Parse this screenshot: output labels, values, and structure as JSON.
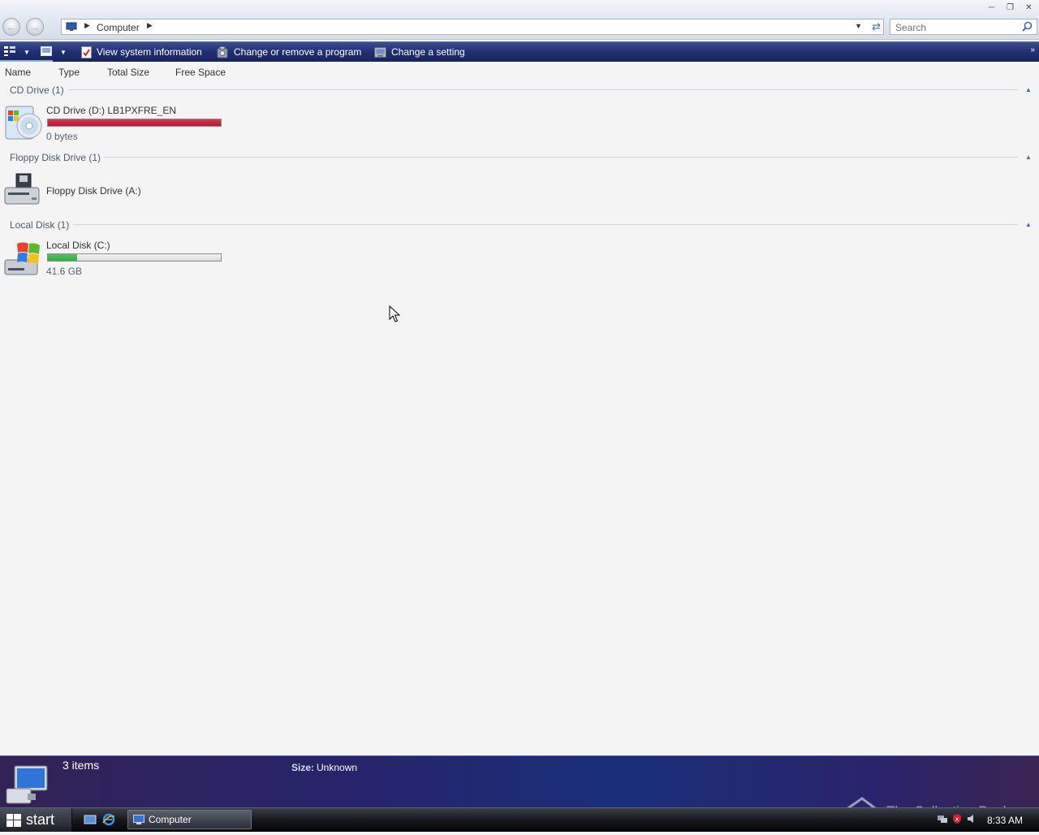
{
  "window": {
    "address": {
      "crumbs": [
        "Computer"
      ]
    },
    "search": {
      "placeholder": "Search"
    }
  },
  "commandbar": {
    "items": [
      {
        "label": "View system information",
        "icon": "system-info-icon"
      },
      {
        "label": "Change or remove a program",
        "icon": "programs-icon"
      },
      {
        "label": "Change a setting",
        "icon": "control-panel-icon"
      }
    ]
  },
  "columns": [
    "Name",
    "Type",
    "Total Size",
    "Free Space"
  ],
  "groups": [
    {
      "title": "CD Drive (1)",
      "drive": {
        "label": "CD Drive (D:) LB1PXFRE_EN",
        "free": "0 bytes",
        "usage_fraction": 1.0,
        "bar_color": "#c8102e"
      }
    },
    {
      "title": "Floppy Disk Drive (1)",
      "drive": {
        "label": "Floppy Disk Drive (A:)"
      }
    },
    {
      "title": "Local Disk (1)",
      "drive": {
        "label": "Local Disk (C:)",
        "free": "41.6 GB",
        "usage_fraction": 0.17,
        "bar_color": "#2fb33c"
      }
    }
  ],
  "details": {
    "count": "3 items",
    "size_label": "Size:",
    "size_value": "Unknown",
    "watermark": "The Collection Book"
  },
  "taskbar": {
    "start_label": "start",
    "task_label": "Computer",
    "clock": "8:33 AM"
  },
  "colors": {
    "commandbar": "#1f2f6f",
    "details_pane": "#26246c",
    "accent": "#2fb33c",
    "alert": "#c8102e"
  }
}
